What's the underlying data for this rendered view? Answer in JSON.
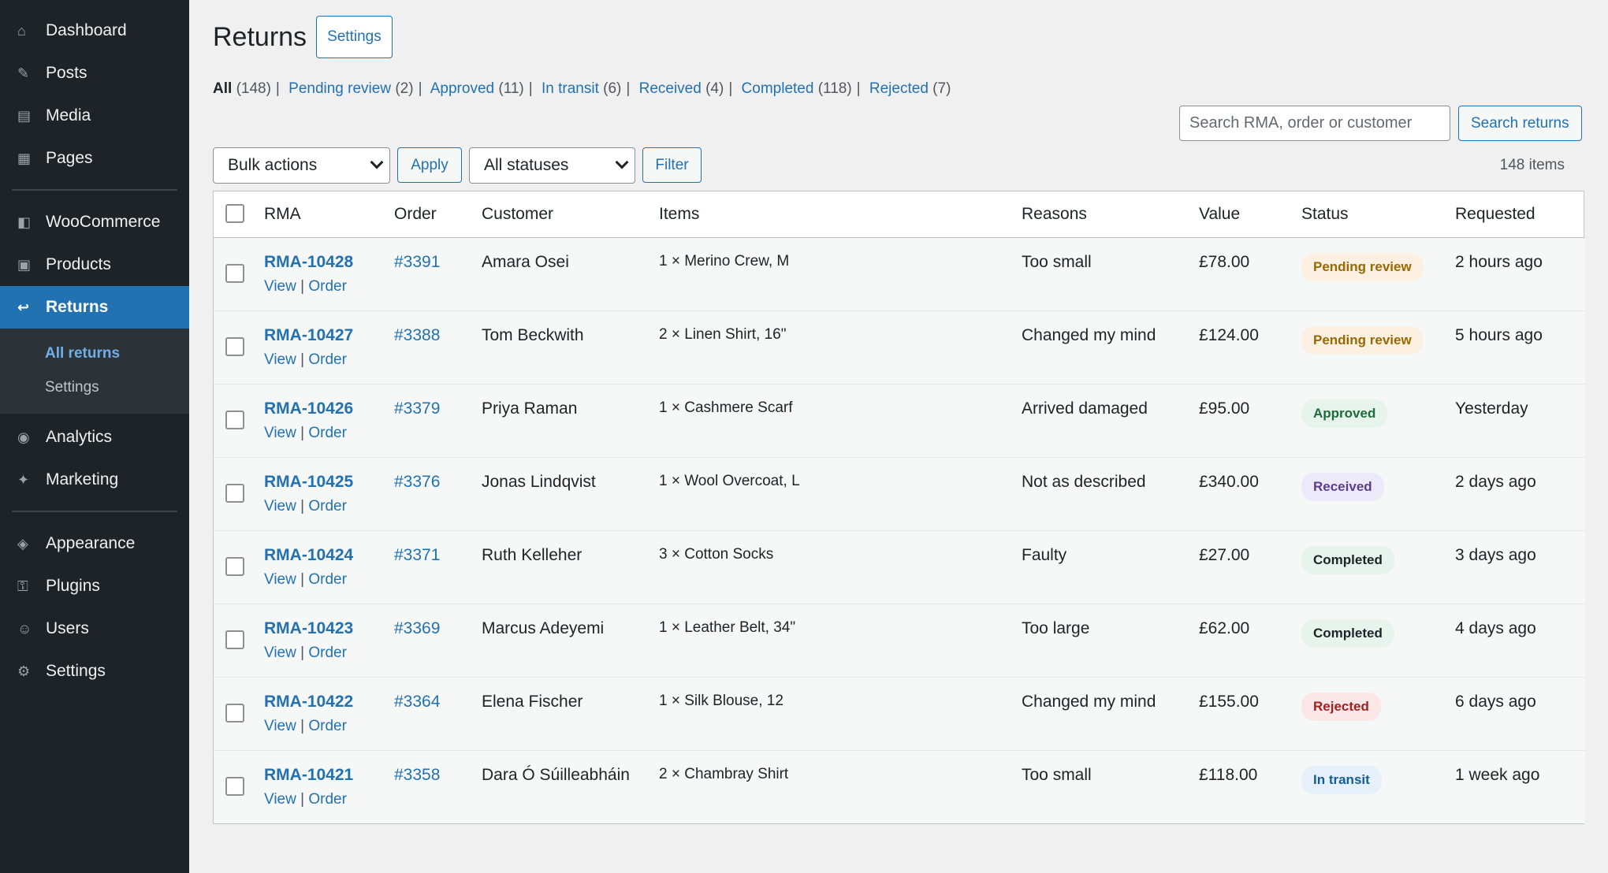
{
  "sidebar": {
    "items": [
      {
        "label": "Dashboard",
        "icon": "⌂"
      },
      {
        "label": "Posts",
        "icon": "✎"
      },
      {
        "label": "Media",
        "icon": "▤"
      },
      {
        "label": "Pages",
        "icon": "▦"
      },
      {
        "label": "WooCommerce",
        "icon": "◧"
      },
      {
        "label": "Products",
        "icon": "▣"
      },
      {
        "label": "Returns",
        "icon": "↩"
      },
      {
        "label": "Analytics",
        "icon": "◉"
      },
      {
        "label": "Marketing",
        "icon": "✦"
      },
      {
        "label": "Appearance",
        "icon": "◈"
      },
      {
        "label": "Plugins",
        "icon": "⚿"
      },
      {
        "label": "Users",
        "icon": "☺"
      },
      {
        "label": "Settings",
        "icon": "⚙"
      }
    ],
    "submenu": {
      "all_returns": "All returns",
      "settings": "Settings"
    }
  },
  "header": {
    "title": "Returns",
    "settings_button": "Settings"
  },
  "filters": {
    "all": {
      "label": "All",
      "count": "(148)"
    },
    "pending": {
      "label": "Pending review",
      "count": "(2)"
    },
    "approved": {
      "label": "Approved",
      "count": "(11)"
    },
    "in_transit": {
      "label": "In transit",
      "count": "(6)"
    },
    "received": {
      "label": "Received",
      "count": "(4)"
    },
    "completed": {
      "label": "Completed",
      "count": "(118)"
    },
    "rejected": {
      "label": "Rejected",
      "count": "(7)"
    }
  },
  "search": {
    "placeholder": "Search RMA, order or customer",
    "button": "Search returns"
  },
  "tablenav": {
    "bulk_actions": "Bulk actions",
    "apply": "Apply",
    "status_filter": "All statuses",
    "filter": "Filter",
    "items_count": "148 items"
  },
  "table": {
    "columns": {
      "rma": "RMA",
      "order": "Order",
      "customer": "Customer",
      "items": "Items",
      "reasons": "Reasons",
      "value": "Value",
      "status": "Status",
      "requested": "Requested"
    },
    "action_view": "View",
    "action_order": "Order",
    "rows": [
      {
        "rma": "RMA-10428",
        "order": "#3391",
        "customer": "Amara Osei",
        "items": "1 × Merino Crew, M",
        "reason": "Too small",
        "value": "£78.00",
        "status": "Pending review",
        "status_key": "pending",
        "requested": "2 hours ago"
      },
      {
        "rma": "RMA-10427",
        "order": "#3388",
        "customer": "Tom Beckwith",
        "items": "2 × Linen Shirt, 16\"",
        "reason": "Changed my mind",
        "value": "£124.00",
        "status": "Pending review",
        "status_key": "pending",
        "requested": "5 hours ago"
      },
      {
        "rma": "RMA-10426",
        "order": "#3379",
        "customer": "Priya Raman",
        "items": "1 × Cashmere Scarf",
        "reason": "Arrived damaged",
        "value": "£95.00",
        "status": "Approved",
        "status_key": "approved",
        "requested": "Yesterday"
      },
      {
        "rma": "RMA-10425",
        "order": "#3376",
        "customer": "Jonas Lindqvist",
        "items": "1 × Wool Overcoat, L",
        "reason": "Not as described",
        "value": "£340.00",
        "status": "Received",
        "status_key": "received",
        "requested": "2 days ago"
      },
      {
        "rma": "RMA-10424",
        "order": "#3371",
        "customer": "Ruth Kelleher",
        "items": "3 × Cotton Socks",
        "reason": "Faulty",
        "value": "£27.00",
        "status": "Completed",
        "status_key": "completed",
        "requested": "3 days ago"
      },
      {
        "rma": "RMA-10423",
        "order": "#3369",
        "customer": "Marcus Adeyemi",
        "items": "1 × Leather Belt, 34\"",
        "reason": "Too large",
        "value": "£62.00",
        "status": "Completed",
        "status_key": "completed",
        "requested": "4 days ago"
      },
      {
        "rma": "RMA-10422",
        "order": "#3364",
        "customer": "Elena Fischer",
        "items": "1 × Silk Blouse, 12",
        "reason": "Changed my mind",
        "value": "£155.00",
        "status": "Rejected",
        "status_key": "rejected",
        "requested": "6 days ago"
      },
      {
        "rma": "RMA-10421",
        "order": "#3358",
        "customer": "Dara Ó Súilleabháin",
        "items": "2 × Chambray Shirt",
        "reason": "Too small",
        "value": "£118.00",
        "status": "In transit",
        "status_key": "transit",
        "requested": "1 week ago"
      }
    ]
  },
  "colors": {
    "sidebar_bg": "#1d2327",
    "accent": "#2271b1",
    "page_bg": "#f0f0f1"
  }
}
